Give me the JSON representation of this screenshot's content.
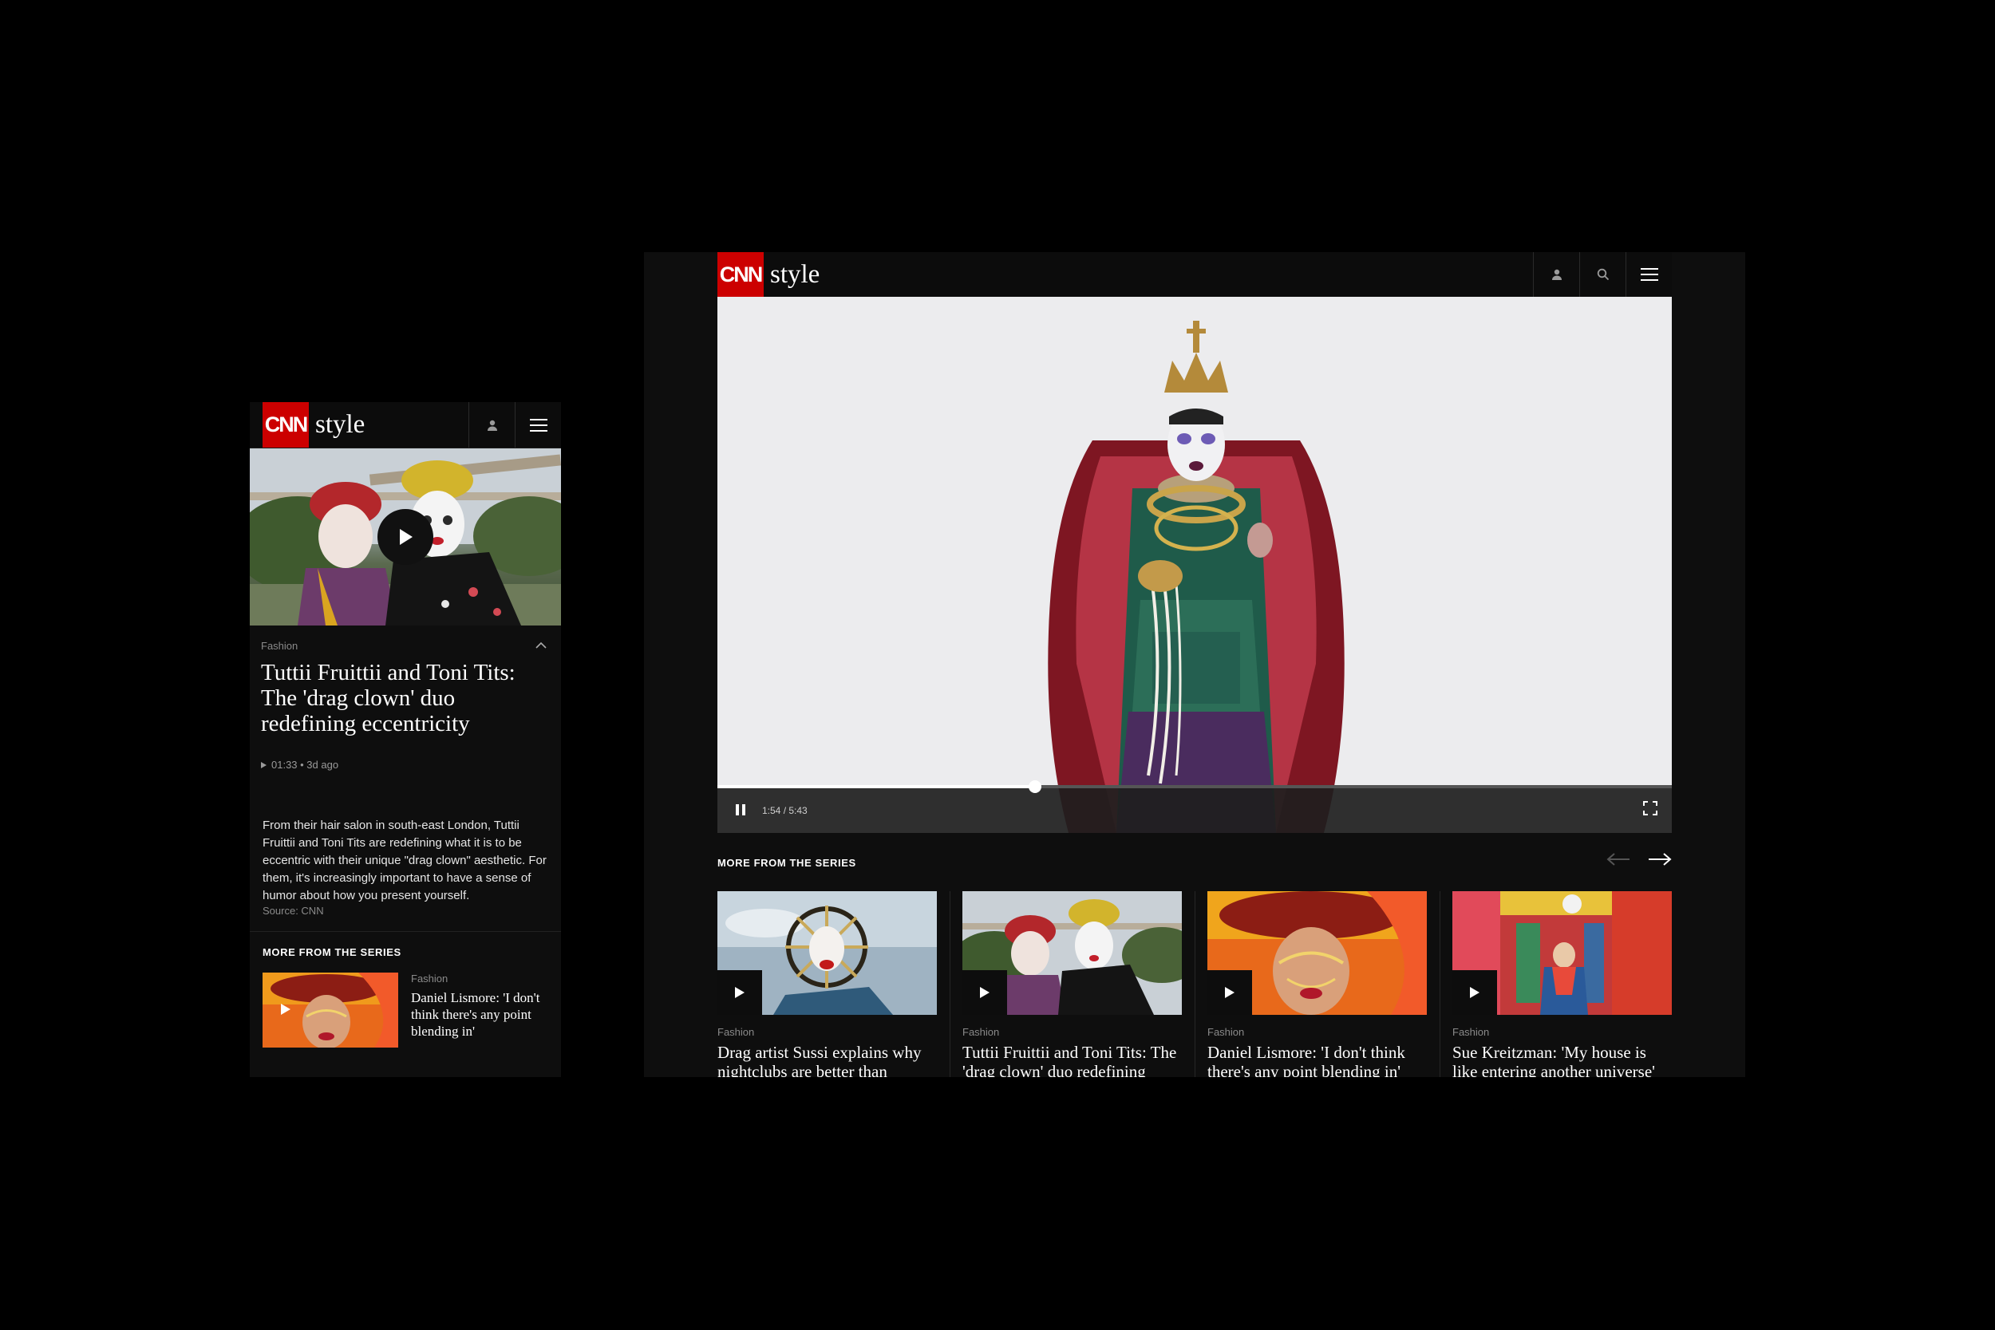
{
  "brand": {
    "logo_text": "CNN",
    "section_word": "style",
    "logo_color": "#cc0000"
  },
  "mobile": {
    "article": {
      "kicker": "Fashion",
      "title": "Tuttii Fruittii and Toni Tits: The 'drag clown' duo redefining eccentricity",
      "duration_meta": "01:33 • 3d ago",
      "description": "From their hair salon in south-east London, Tuttii Fruittii and Toni Tits are redefining what it is to be eccentric with their unique \"drag clown\" aesthetic. For them, it's increasingly important to have a sense of humor about how you present yourself.",
      "source": "Source: CNN"
    },
    "series": {
      "heading": "MORE FROM THE SERIES",
      "cards": [
        {
          "kicker": "Fashion",
          "title": "Daniel Lismore: 'I don't think there's any point blending in'"
        }
      ]
    }
  },
  "desktop": {
    "player": {
      "time": "1:54 / 5:43",
      "progress": 0.333
    },
    "series": {
      "heading": "MORE FROM THE SERIES",
      "cards": [
        {
          "kicker": "Fashion",
          "title": "Drag artist Sussi explains why nightclubs are better than"
        },
        {
          "kicker": "Fashion",
          "title": "Tuttii Fruittii and Toni Tits: The 'drag clown' duo redefining"
        },
        {
          "kicker": "Fashion",
          "title": "Daniel Lismore: 'I don't think there's any point blending in'"
        },
        {
          "kicker": "Fashion",
          "title": "Sue Kreitzman: 'My house is like entering another universe'"
        }
      ]
    }
  }
}
